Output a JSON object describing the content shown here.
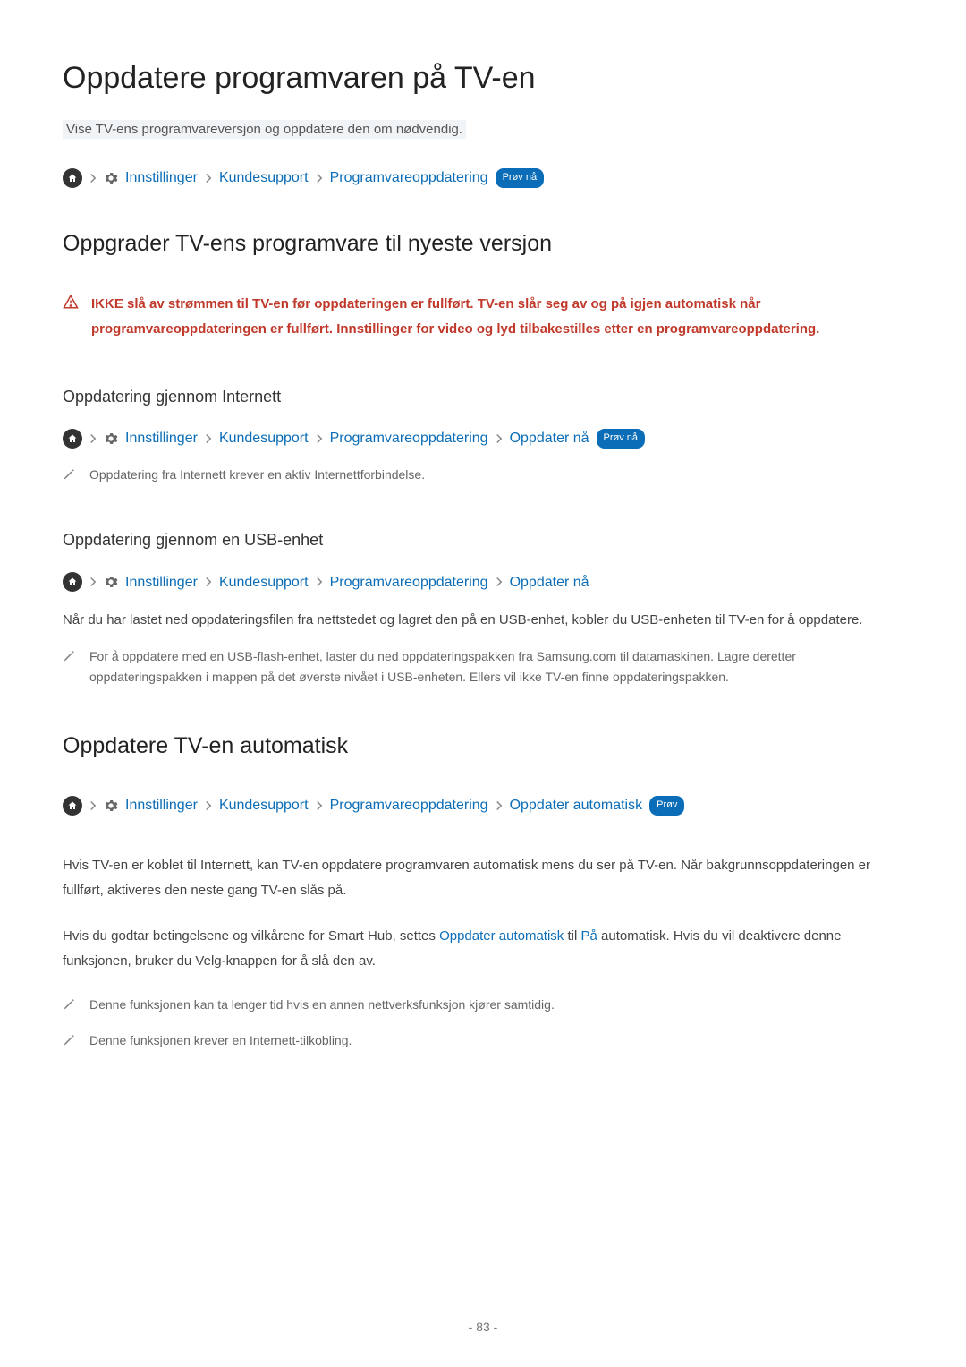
{
  "page": {
    "title": "Oppdatere programvaren på TV-en",
    "subtitle": "Vise TV-ens programvareversjon og oppdatere den om nødvendig.",
    "page_number": "- 83 -"
  },
  "crumb_labels": {
    "settings": "Innstillinger",
    "support": "Kundesupport",
    "swupdate": "Programvareoppdatering",
    "update_now": "Oppdater nå",
    "auto_update": "Oppdater automatisk"
  },
  "badges": {
    "try_now": "Prøv nå",
    "try": "Prøv"
  },
  "section1": {
    "heading": "Oppgrader TV-ens programvare til nyeste versjon",
    "warning": "IKKE slå av strømmen til TV-en før oppdateringen er fullført. TV-en slår seg av og på igjen automatisk når programvareoppdateringen er fullført. Innstillinger for video og lyd tilbakestilles etter en programvareoppdatering."
  },
  "section2": {
    "heading": "Oppdatering gjennom Internett",
    "note": "Oppdatering fra Internett krever en aktiv Internettforbindelse."
  },
  "section3": {
    "heading": "Oppdatering gjennom en USB-enhet",
    "body": "Når du har lastet ned oppdateringsfilen fra nettstedet og lagret den på en USB-enhet, kobler du USB-enheten til TV-en for å oppdatere.",
    "note": "For å oppdatere med en USB-flash-enhet, laster du ned oppdateringspakken fra Samsung.com til datamaskinen. Lagre deretter oppdateringspakken i mappen på det øverste nivået i USB-enheten. Ellers vil ikke TV-en finne oppdateringspakken."
  },
  "section4": {
    "heading": "Oppdatere TV-en automatisk",
    "body1": "Hvis TV-en er koblet til Internett, kan TV-en oppdatere programvaren automatisk mens du ser på TV-en. Når bakgrunnsoppdateringen er fullført, aktiveres den neste gang TV-en slås på.",
    "body2_pre": "Hvis du godtar betingelsene og vilkårene for Smart Hub, settes ",
    "body2_link1": "Oppdater automatisk",
    "body2_mid": " til ",
    "body2_link2": "På",
    "body2_post": " automatisk. Hvis du vil deaktivere denne funksjonen, bruker du Velg-knappen for å slå den av.",
    "note1": "Denne funksjonen kan ta lenger tid hvis en annen nettverksfunksjon kjører samtidig.",
    "note2": "Denne funksjonen krever en Internett-tilkobling."
  }
}
